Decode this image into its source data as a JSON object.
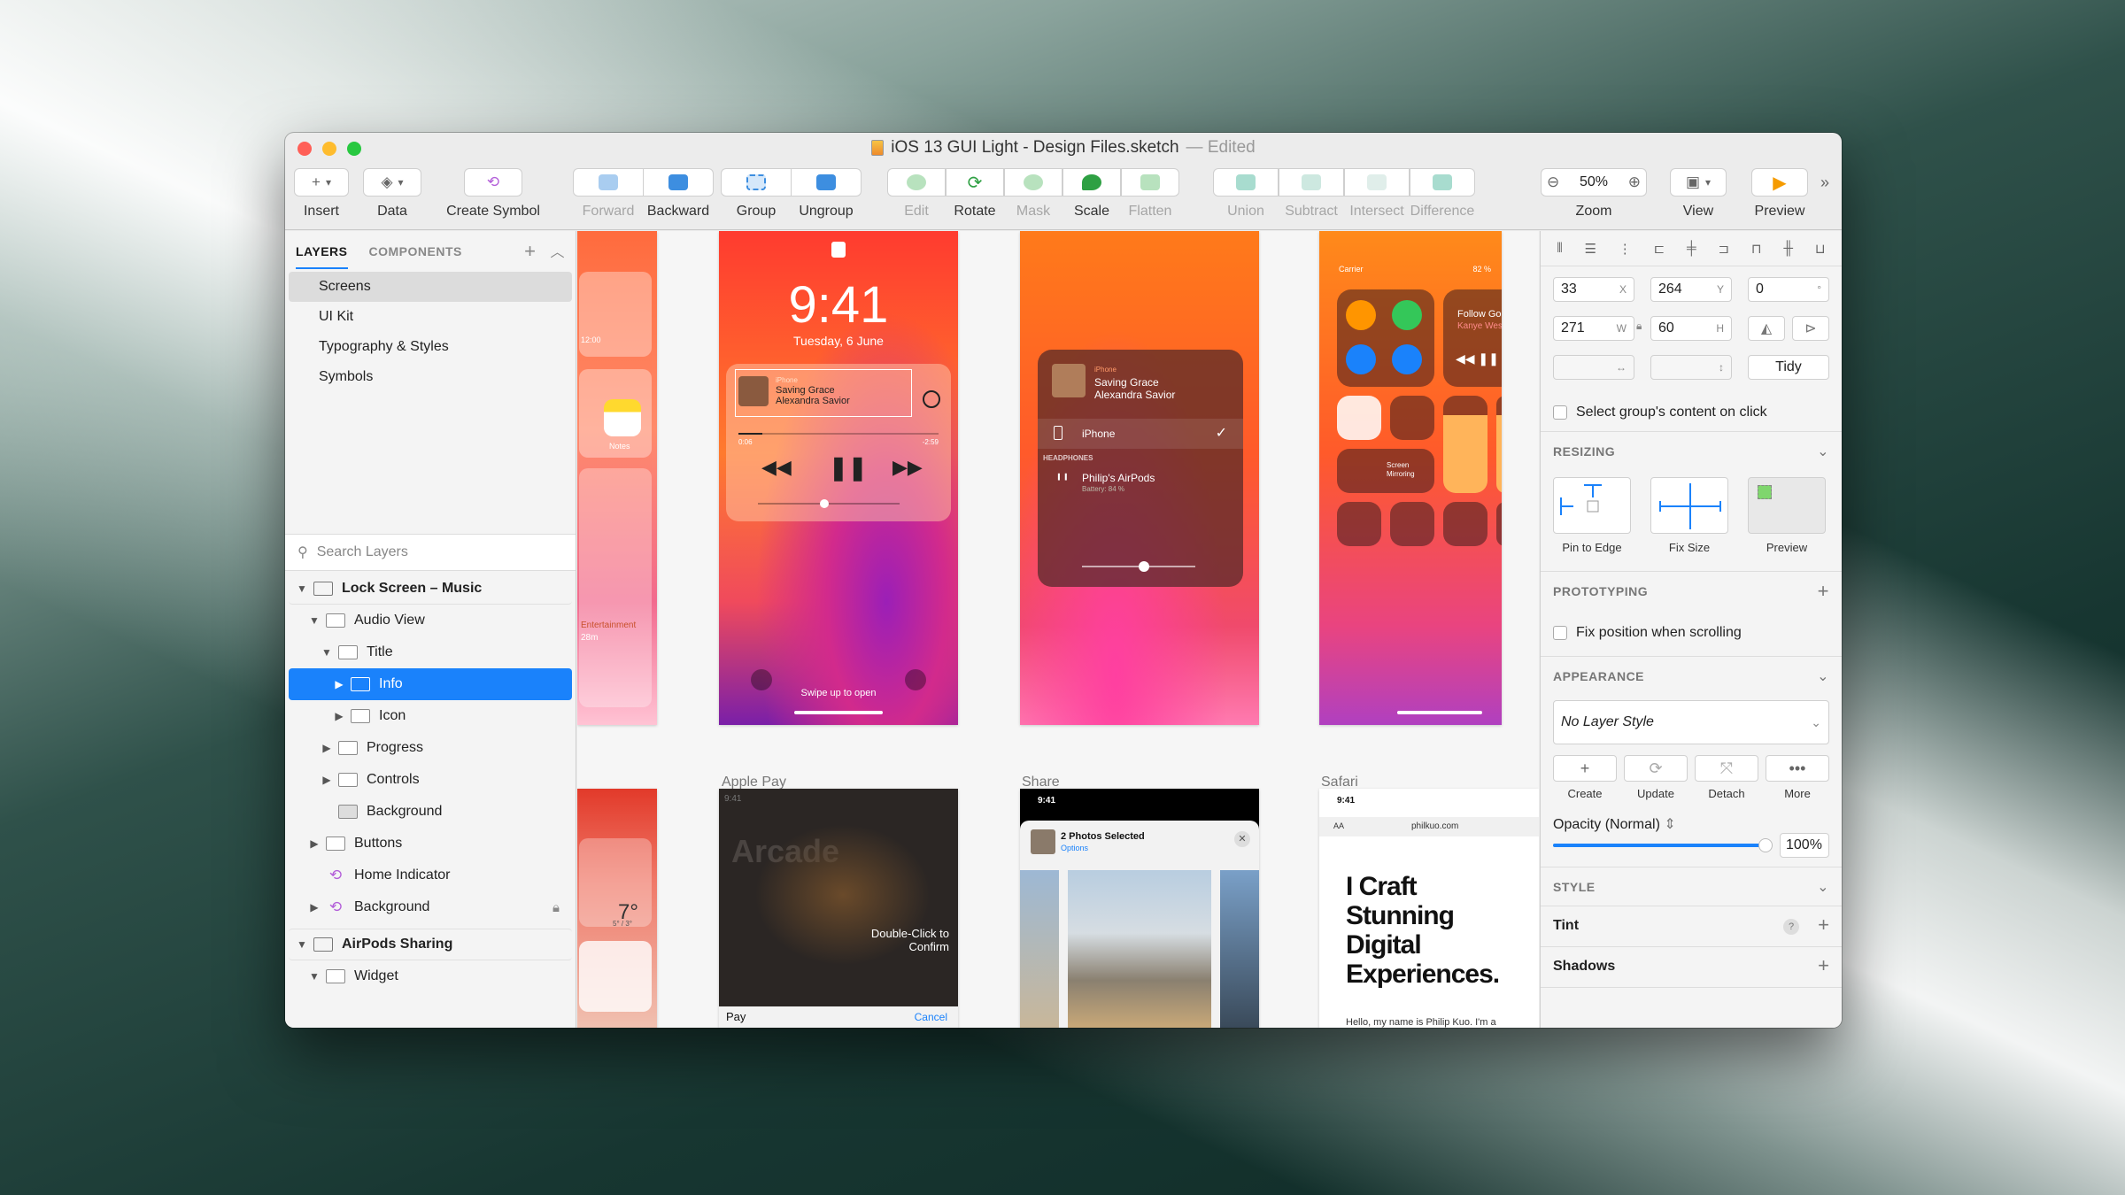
{
  "window": {
    "title": "iOS 13 GUI Light - Design Files.sketch",
    "edited": "— Edited",
    "lights": [
      "#ff5f57",
      "#febc2e",
      "#28c840"
    ]
  },
  "toolbar": {
    "insert": "Insert",
    "data": "Data",
    "create_symbol": "Create Symbol",
    "forward": "Forward",
    "backward": "Backward",
    "group": "Group",
    "ungroup": "Ungroup",
    "edit": "Edit",
    "rotate": "Rotate",
    "mask": "Mask",
    "scale": "Scale",
    "flatten": "Flatten",
    "union": "Union",
    "subtract": "Subtract",
    "intersect": "Intersect",
    "difference": "Difference",
    "zoom": "Zoom",
    "zoom_value": "50%",
    "view": "View",
    "preview": "Preview"
  },
  "left_panel": {
    "tabs": [
      "LAYERS",
      "COMPONENTS"
    ],
    "pages": [
      "Screens",
      "UI Kit",
      "Typography & Styles",
      "Symbols"
    ],
    "search_placeholder": "Search Layers",
    "layers": [
      {
        "label": "Lock Screen – Music",
        "kind": "artboard",
        "depth": 0,
        "expanded": true
      },
      {
        "label": "Audio View",
        "kind": "folder",
        "depth": 1,
        "expanded": true
      },
      {
        "label": "Title",
        "kind": "folder",
        "depth": 2,
        "expanded": true
      },
      {
        "label": "Info",
        "kind": "folder",
        "depth": 3,
        "selected": true
      },
      {
        "label": "Icon",
        "kind": "folder",
        "depth": 3
      },
      {
        "label": "Progress",
        "kind": "folder",
        "depth": 2
      },
      {
        "label": "Controls",
        "kind": "folder",
        "depth": 2
      },
      {
        "label": "Background",
        "kind": "folder",
        "depth": 2,
        "leaf": true
      },
      {
        "label": "Buttons",
        "kind": "folder",
        "depth": 1
      },
      {
        "label": "Home Indicator",
        "kind": "symbol",
        "depth": 1,
        "leaf": true
      },
      {
        "label": "Background",
        "kind": "symbol",
        "depth": 1,
        "locked": true
      },
      {
        "label": "AirPods Sharing",
        "kind": "artboard",
        "depth": 0,
        "expanded": true
      },
      {
        "label": "Widget",
        "kind": "folder",
        "depth": 1,
        "expanded": true
      }
    ]
  },
  "canvas": {
    "lock_screen": {
      "time": "9:41",
      "date": "Tuesday, 6 June",
      "source": "iPhone",
      "song": "Saving Grace",
      "artist": "Alexandra Savior",
      "elapsed": "0:06",
      "remaining": "-2:59",
      "swipe": "Swipe up to open"
    },
    "airplay": {
      "source": "iPhone",
      "song": "Saving Grace",
      "artist": "Alexandra Savior",
      "device": "iPhone",
      "section": "HEADPHONES",
      "headphones": "Philip's AirPods",
      "battery": "Battery: 84 %"
    },
    "control_center": {
      "carrier": "Carrier",
      "battery": "82 %",
      "song": "Follow God",
      "artist": "Kanye West",
      "mirroring": "Screen Mirroring"
    },
    "partial_left": {
      "time": "12:00",
      "notes": "Notes",
      "entertainment": "Entertainment",
      "duration": "28m",
      "temp": "7°",
      "temp_range": "5° / 3°"
    },
    "labels": {
      "apple_pay": "Apple Pay",
      "share": "Share",
      "safari": "Safari"
    },
    "apple_pay": {
      "time": "9:41",
      "merchant": "Arcade",
      "prompt": "Double-Click to Confirm",
      "pay": "Pay",
      "cancel": "Cancel"
    },
    "share": {
      "time": "9:41",
      "title": "2 Photos Selected",
      "options": "Options"
    },
    "safari": {
      "time": "9:41",
      "aa": "AA",
      "url": "philkuo.com",
      "headline": "I Craft Stunning Digital Experiences.",
      "body": "Hello, my name is Philip Kuo. I'm a"
    }
  },
  "inspector": {
    "x": "33",
    "y": "264",
    "rotation": "0",
    "w": "271",
    "h": "60",
    "x_unit": "X",
    "y_unit": "Y",
    "w_unit": "W",
    "h_unit": "H",
    "rot_unit": "°",
    "tidy": "Tidy",
    "select_group": "Select group's content on click",
    "resizing": "RESIZING",
    "pin_to_edge": "Pin to Edge",
    "fix_size": "Fix Size",
    "preview": "Preview",
    "prototyping": "PROTOTYPING",
    "fix_position": "Fix position when scrolling",
    "appearance": "APPEARANCE",
    "layer_style": "No Layer Style",
    "create": "Create",
    "update": "Update",
    "detach": "Detach",
    "more": "More",
    "opacity_label": "Opacity (Normal)",
    "opacity": "100%",
    "opacity_value": 1.0,
    "style": "STYLE",
    "tint": "Tint",
    "shadows": "Shadows"
  }
}
